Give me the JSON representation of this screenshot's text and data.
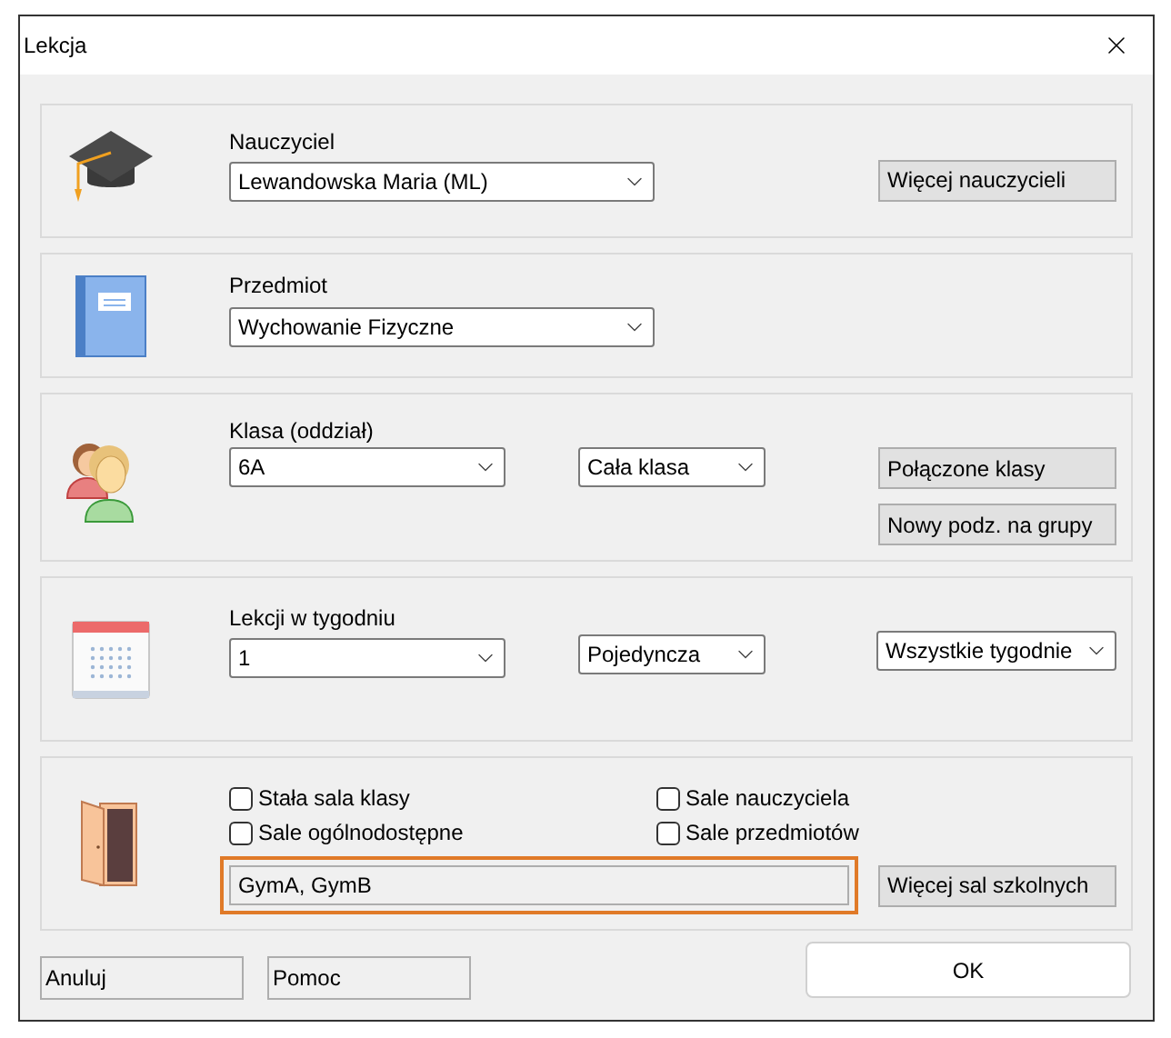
{
  "window": {
    "title": "Lekcja"
  },
  "sections": [
    {
      "kind": "teacher",
      "label": "Nauczyciel",
      "select": "Lewandowska Maria (ML)",
      "buttons": [
        "Więcej nauczycieli"
      ]
    },
    {
      "kind": "subject",
      "label": "Przedmiot",
      "select": "Wychowanie Fizyczne"
    },
    {
      "kind": "class",
      "label": "Klasa (oddział)",
      "select": "6A",
      "group_select": "Cała klasa",
      "buttons": [
        "Połączone klasy",
        "Nowy podz. na grupy"
      ]
    },
    {
      "kind": "lessons",
      "label": "Lekcji w tygodniu",
      "select": "1",
      "type_select": "Pojedyncza",
      "weeks_select": "Wszystkie tygodnie"
    },
    {
      "kind": "rooms",
      "checkboxes": [
        {
          "label": "Stała sala klasy",
          "checked": false
        },
        {
          "label": "Sale nauczyciela",
          "checked": false
        },
        {
          "label": "Sale ogólnodostępne",
          "checked": false
        },
        {
          "label": "Sale przedmiotów",
          "checked": false
        }
      ],
      "rooms_field": {
        "value": "GymA, GymB",
        "highlighted": true
      },
      "buttons": [
        "Więcej sal szkolnych"
      ]
    }
  ],
  "footer": {
    "buttons": [
      "Anuluj",
      "Pomoc"
    ],
    "ok": "OK"
  }
}
